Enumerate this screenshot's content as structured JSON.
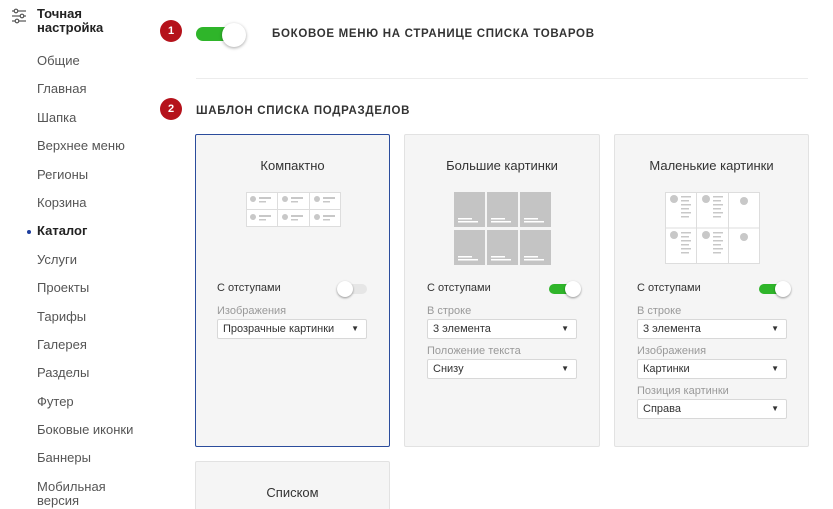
{
  "sidebar": {
    "title": "Точная настройка",
    "items": [
      {
        "label": "Общие"
      },
      {
        "label": "Главная"
      },
      {
        "label": "Шапка"
      },
      {
        "label": "Верхнее меню"
      },
      {
        "label": "Регионы"
      },
      {
        "label": "Корзина"
      },
      {
        "label": "Каталог",
        "active": true
      },
      {
        "label": "Услуги"
      },
      {
        "label": "Проекты"
      },
      {
        "label": "Тарифы"
      },
      {
        "label": "Галерея"
      },
      {
        "label": "Разделы"
      },
      {
        "label": "Футер"
      },
      {
        "label": "Боковые иконки"
      },
      {
        "label": "Баннеры"
      },
      {
        "label": "Мобильная версия"
      }
    ]
  },
  "main": {
    "step1": {
      "badge": "1",
      "label": "БОКОВОЕ МЕНЮ НА СТРАНИЦЕ СПИСКА ТОВАРОВ",
      "toggle_on": true
    },
    "step2": {
      "badge": "2",
      "label": "ШАБЛОН СПИСКА ПОДРАЗДЕЛОВ"
    },
    "cards": {
      "compact": {
        "title": "Компактно",
        "indent_label": "С отступами",
        "indent_on": false,
        "images_label": "Изображения",
        "images_value": "Прозрачные картинки"
      },
      "big": {
        "title": "Большие картинки",
        "indent_label": "С отступами",
        "indent_on": true,
        "row_label": "В строке",
        "row_value": "3 элемента",
        "text_pos_label": "Положение текста",
        "text_pos_value": "Снизу"
      },
      "small": {
        "title": "Маленькие картинки",
        "indent_label": "С отступами",
        "indent_on": true,
        "row_label": "В строке",
        "row_value": "3 элемента",
        "images_label": "Изображения",
        "images_value": "Картинки",
        "pic_pos_label": "Позиция картинки",
        "pic_pos_value": "Справа"
      },
      "list": {
        "title": "Списком"
      }
    }
  },
  "colors": {
    "accent_green": "#2fb52a",
    "badge_red": "#b5121b",
    "selected_border": "#2b4c9c",
    "active_dot": "#1d3e9e"
  }
}
